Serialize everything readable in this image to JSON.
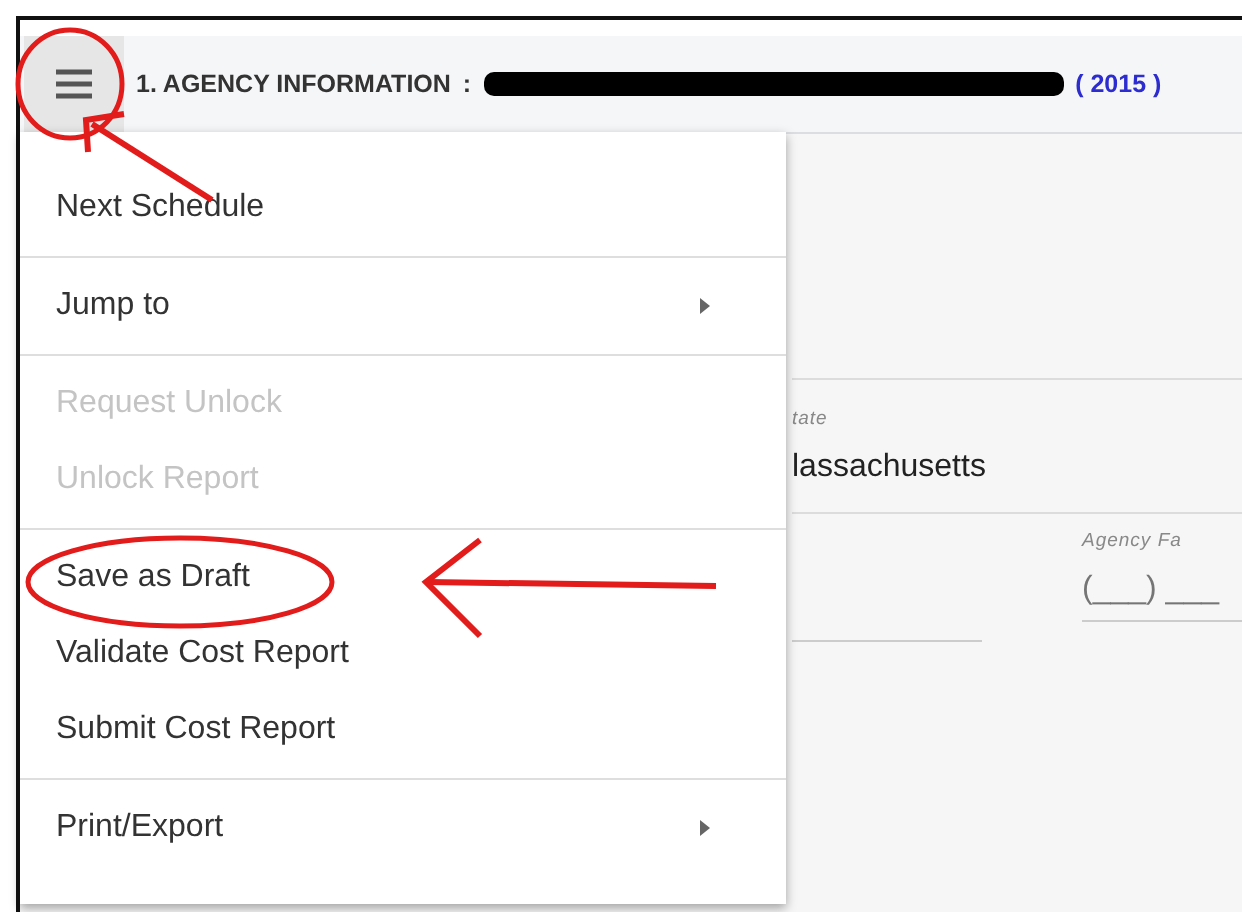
{
  "header": {
    "title": "1. AGENCY INFORMATION",
    "separator": ":",
    "year": "( 2015 )",
    "redacted": true
  },
  "menu": {
    "groups": [
      [
        {
          "label": "Next Schedule",
          "kind": "item",
          "disabled": false
        }
      ],
      [
        {
          "label": "Jump to",
          "kind": "submenu",
          "disabled": false
        }
      ],
      [
        {
          "label": "Request Unlock",
          "kind": "item",
          "disabled": true
        },
        {
          "label": "Unlock Report",
          "kind": "item",
          "disabled": true
        }
      ],
      [
        {
          "label": "Save as Draft",
          "kind": "item",
          "disabled": false
        },
        {
          "label": "Validate Cost Report",
          "kind": "item",
          "disabled": false
        },
        {
          "label": "Submit Cost Report",
          "kind": "item",
          "disabled": false
        }
      ],
      [
        {
          "label": "Print/Export",
          "kind": "submenu",
          "disabled": false
        }
      ]
    ]
  },
  "form": {
    "state_label": "tate",
    "state_value": "lassachusetts",
    "fax_label": "Agency Fa",
    "fax_placeholder": "(___) ___"
  }
}
